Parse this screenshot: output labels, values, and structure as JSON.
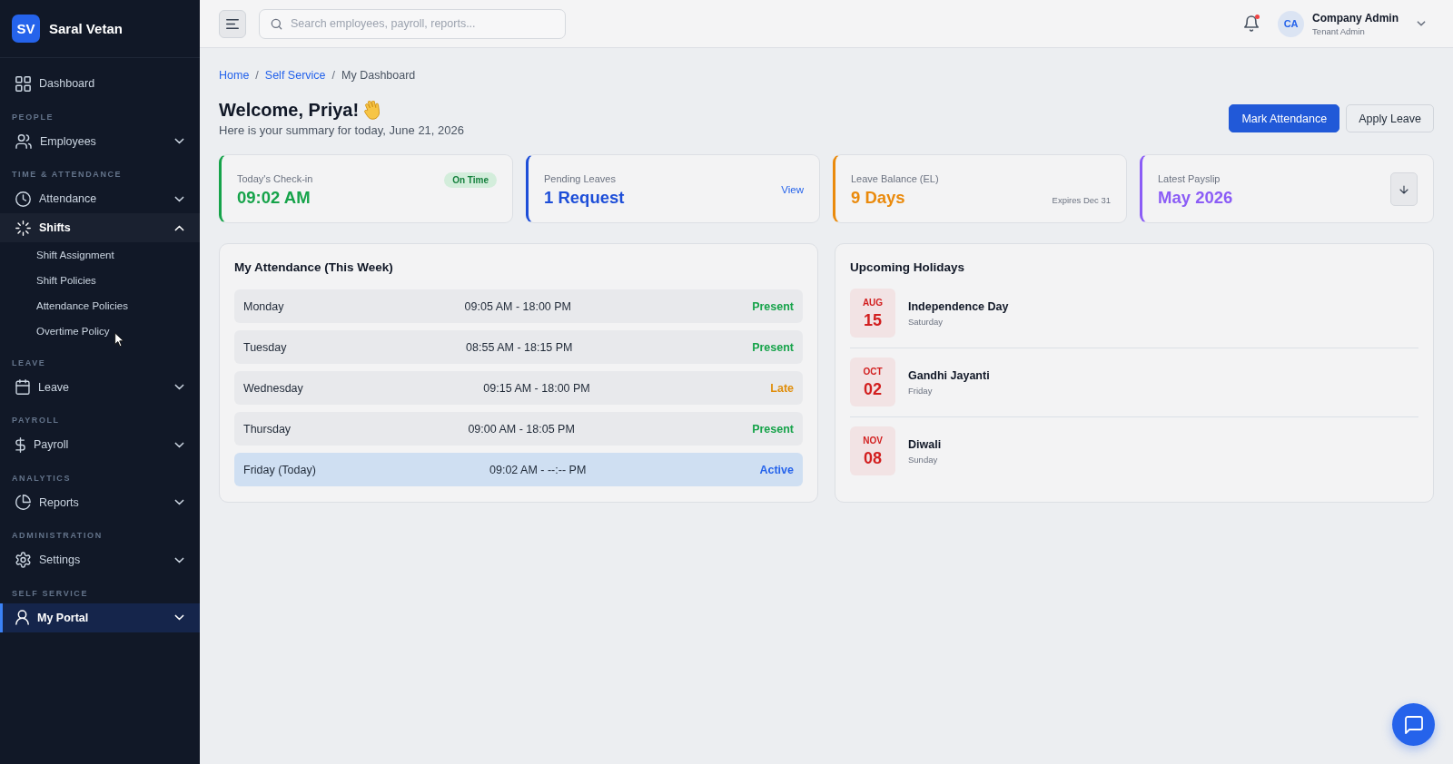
{
  "sidebar": {
    "brand": {
      "initials": "SV",
      "name": "Saral Vetan"
    },
    "top_item": {
      "label": "Dashboard",
      "selected": false
    },
    "sections": [
      {
        "heading": "PEOPLE",
        "items": [
          {
            "label": "Employees",
            "selected": false,
            "expanded": false
          }
        ]
      },
      {
        "heading": "TIME & ATTENDANCE",
        "items": [
          {
            "label": "Attendance",
            "selected": false,
            "expanded": false
          },
          {
            "label": "Shifts",
            "selected": false,
            "expanded": true,
            "children": [
              {
                "label": "Shift Assignment",
                "selected": false
              },
              {
                "label": "Shift Policies",
                "selected": false
              },
              {
                "label": "Attendance Policies",
                "selected": false
              },
              {
                "label": "Overtime Policy",
                "selected": false
              }
            ]
          }
        ]
      },
      {
        "heading": "LEAVE",
        "items": [
          {
            "label": "Leave",
            "selected": false,
            "expanded": false
          }
        ]
      },
      {
        "heading": "PAYROLL",
        "items": [
          {
            "label": "Payroll",
            "selected": false,
            "expanded": false
          }
        ]
      },
      {
        "heading": "ANALYTICS",
        "items": [
          {
            "label": "Reports",
            "selected": false,
            "expanded": false
          }
        ]
      },
      {
        "heading": "ADMINISTRATION",
        "items": [
          {
            "label": "Settings",
            "selected": false,
            "expanded": false
          }
        ]
      },
      {
        "heading": "SELF SERVICE",
        "items": [
          {
            "label": "My Portal",
            "selected": true,
            "expanded": false
          }
        ]
      }
    ]
  },
  "topbar": {
    "search": {
      "placeholder": "Search employees, payroll, reports..."
    },
    "notifications": {
      "unread": true
    },
    "user": {
      "initials": "CA",
      "name": "Company Admin",
      "role": "Tenant Admin"
    }
  },
  "breadcrumb": {
    "separator": "/",
    "items": [
      {
        "label": "Home",
        "kind": "link"
      },
      {
        "label": "Self Service",
        "kind": "link"
      },
      {
        "label": "My Dashboard",
        "kind": "current"
      }
    ]
  },
  "header": {
    "title": "Welcome, Priya!",
    "subtitle": "Here is your summary for today, June 21, 2026",
    "actions": [
      {
        "label": "Mark Attendance",
        "kind": "primary"
      },
      {
        "label": "Apply Leave",
        "kind": "secondary"
      }
    ]
  },
  "stats": [
    {
      "label": "Today's Check-in",
      "value": "09:02 AM",
      "color": "#16a34a",
      "kind": "badge",
      "badge": "On Time"
    },
    {
      "label": "Pending Leaves",
      "value": "1 Request",
      "color": "#1d4ed8",
      "kind": "link",
      "link": "View"
    },
    {
      "label": "Leave Balance (EL)",
      "value": "9 Days",
      "color": "#ea8a0c",
      "kind": "note",
      "note": "Expires Dec 31"
    },
    {
      "label": "Latest Payslip",
      "value": "May 2026",
      "color": "#8b5cf6",
      "kind": "download"
    }
  ],
  "attendance": {
    "title": "My Attendance (This Week)",
    "rows": [
      {
        "day": "Monday",
        "hours": "09:05 AM - 18:00 PM",
        "status": "Present",
        "color": "#16a34a",
        "today": false
      },
      {
        "day": "Tuesday",
        "hours": "08:55 AM - 18:15 PM",
        "status": "Present",
        "color": "#16a34a",
        "today": false
      },
      {
        "day": "Wednesday",
        "hours": "09:15 AM - 18:00 PM",
        "status": "Late",
        "color": "#e08e0b",
        "today": false
      },
      {
        "day": "Thursday",
        "hours": "09:00 AM - 18:05 PM",
        "status": "Present",
        "color": "#16a34a",
        "today": false
      },
      {
        "day": "Friday (Today)",
        "hours": "09:02 AM - --:-- PM",
        "status": "Active",
        "color": "#2563eb",
        "today": true
      }
    ]
  },
  "holidays": {
    "title": "Upcoming Holidays",
    "items": [
      {
        "month": "AUG",
        "day": "15",
        "name": "Independence Day",
        "weekday": "Saturday"
      },
      {
        "month": "OCT",
        "day": "02",
        "name": "Gandhi Jayanti",
        "weekday": "Friday"
      },
      {
        "month": "NOV",
        "day": "08",
        "name": "Diwali",
        "weekday": "Sunday"
      }
    ]
  }
}
